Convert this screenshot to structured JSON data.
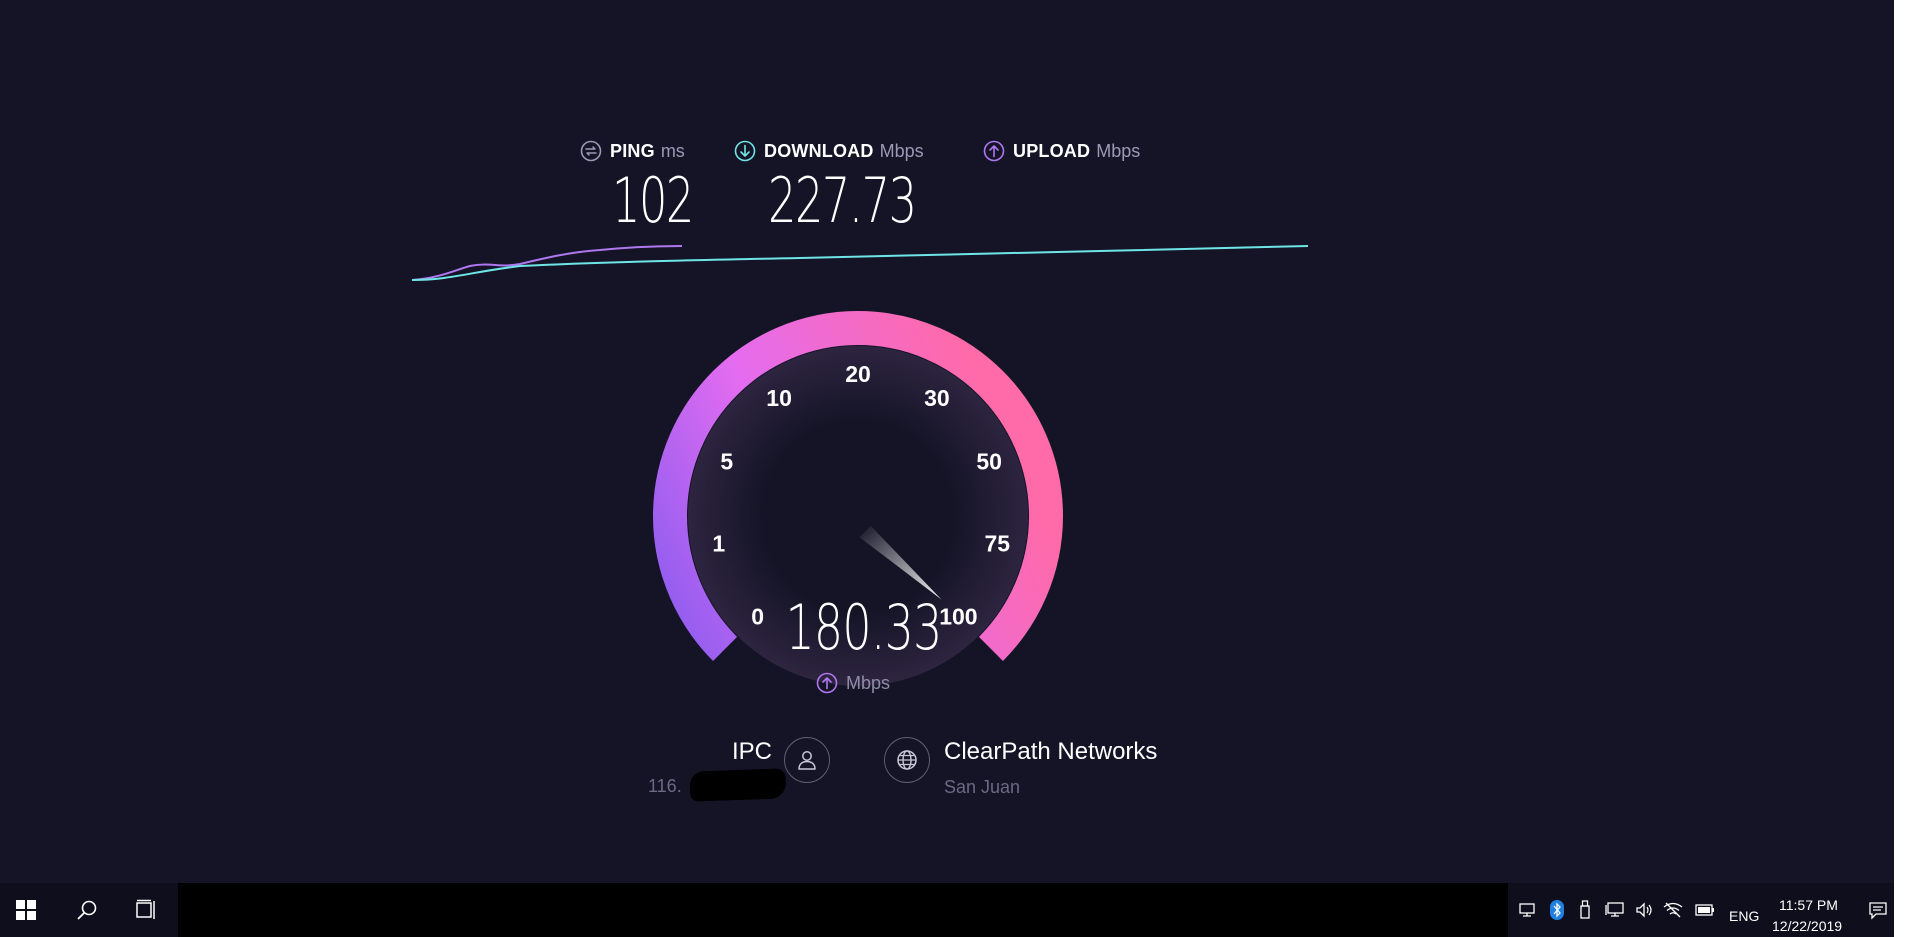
{
  "stats": {
    "ping": {
      "label": "PING",
      "unit": "ms",
      "value": "102"
    },
    "download": {
      "label": "DOWNLOAD",
      "unit": "Mbps",
      "value": "227.73"
    },
    "upload": {
      "label": "UPLOAD",
      "unit": "Mbps",
      "value": ""
    }
  },
  "gauge": {
    "ticks": [
      "0",
      "1",
      "5",
      "10",
      "20",
      "30",
      "50",
      "75",
      "100"
    ],
    "value": "180.33",
    "unit": "Mbps",
    "needle_mbps": 100
  },
  "client": {
    "name": "IPC",
    "ip_prefix": "116."
  },
  "server": {
    "name": "ClearPath Networks",
    "location": "San Juan"
  },
  "taskbar": {
    "language": "ENG",
    "time": "11:57 PM",
    "date": "12/22/2019"
  },
  "colors": {
    "background": "#141426",
    "download_line": "#6ee6e6",
    "upload_line": "#b078f0",
    "gauge_start": "#8a5cf0",
    "gauge_mid": "#f070e8",
    "gauge_end": "#ff6aa8"
  },
  "icons": {
    "ping": "ping-icon",
    "download": "download-arrow-icon",
    "upload": "upload-arrow-icon",
    "client": "user-icon",
    "server": "globe-icon",
    "start": "windows-start-icon",
    "search": "search-icon",
    "taskview": "task-view-icon"
  }
}
